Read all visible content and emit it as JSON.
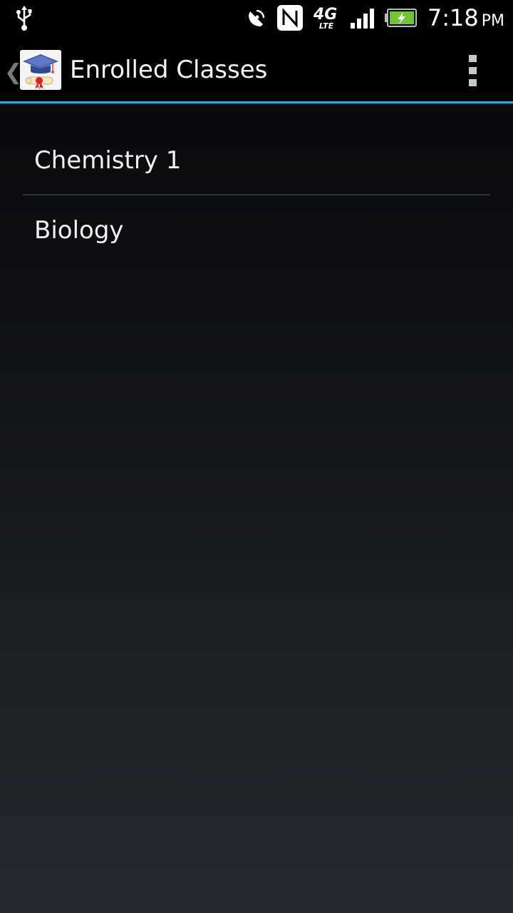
{
  "status_bar": {
    "time": "7:18",
    "ampm": "PM",
    "icons": [
      "usb-icon",
      "satellite-icon",
      "nfc-icon",
      "4g-lte-icon",
      "signal-icon",
      "battery-charging-icon"
    ],
    "network_label": "4G",
    "network_sub": "LTE",
    "battery_color": "#6fc534"
  },
  "action_bar": {
    "title": "Enrolled Classes",
    "up_glyph": "❮",
    "accent_color": "#33a3dc"
  },
  "classes": [
    {
      "name": "Chemistry 1"
    },
    {
      "name": "Biology"
    }
  ]
}
